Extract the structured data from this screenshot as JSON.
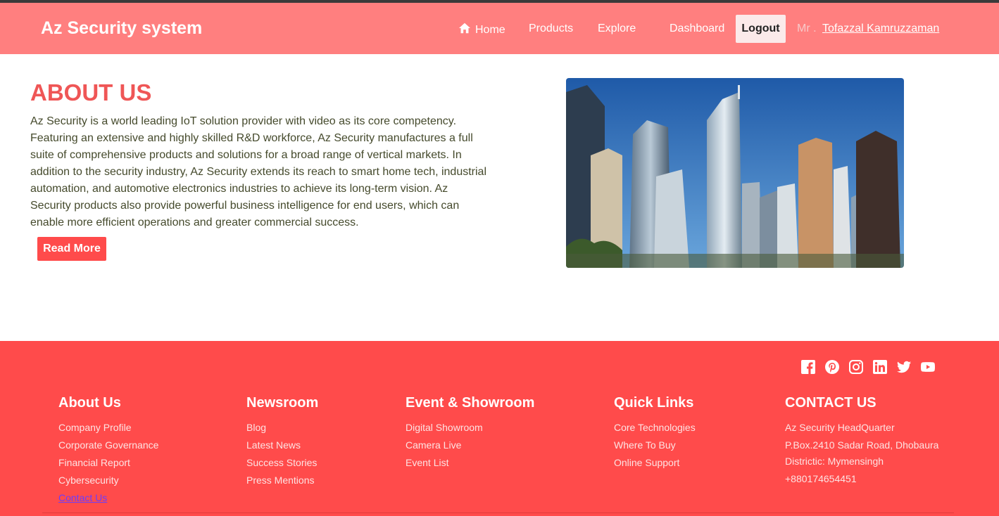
{
  "header": {
    "brand": "Az Security system",
    "nav": {
      "home": "Home",
      "products": "Products",
      "explore": "Explore",
      "dashboard": "Dashboard",
      "logout": "Logout"
    },
    "user_prefix": "Mr .",
    "user_name": "Tofazzal Kamruzzaman"
  },
  "about": {
    "title": "ABOUT US",
    "text": "Az Security is a world leading IoT solution provider with video as its core competency. Featuring an extensive and highly skilled R&D workforce, Az Security manufactures a full suite of comprehensive products and solutions for a broad range of vertical markets. In addition to the security industry, Az Security extends its reach to smart home tech, industrial automation, and automotive electronics industries to achieve its long-term vision. Az Security products also provide powerful business intelligence for end users, which can enable more efficient operations and greater commercial success.",
    "read_more": "Read More"
  },
  "footer": {
    "social_icons": [
      "facebook-icon",
      "pinterest-icon",
      "instagram-icon",
      "linkedin-icon",
      "twitter-icon",
      "youtube-icon"
    ],
    "about": {
      "heading": "About Us",
      "links": [
        "Company Profile",
        "Corporate Governance",
        "Financial Report",
        "Cybersecurity",
        "Contact Us"
      ]
    },
    "newsroom": {
      "heading": "Newsroom",
      "links": [
        "Blog",
        "Latest News",
        "Success Stories",
        "Press Mentions"
      ]
    },
    "events": {
      "heading": "Event & Showroom",
      "links": [
        "Digital Showroom",
        "Camera Live",
        "Event List"
      ]
    },
    "quick": {
      "heading": "Quick Links",
      "links": [
        "Core Technologies",
        "Where To Buy",
        "Online Support"
      ]
    },
    "contact": {
      "heading": "CONTACT US",
      "hq": "Az Security HeadQuarter",
      "address1": "P.Box.2410 Sadar Road, Dhobaura",
      "address2": "Districtic: Mymensingh",
      "phone": "+880174654451"
    }
  },
  "colors": {
    "navbar": "#ff7f7f",
    "footer": "#ff4b4b",
    "title": "#ef5656",
    "button": "#ff4b4b"
  }
}
